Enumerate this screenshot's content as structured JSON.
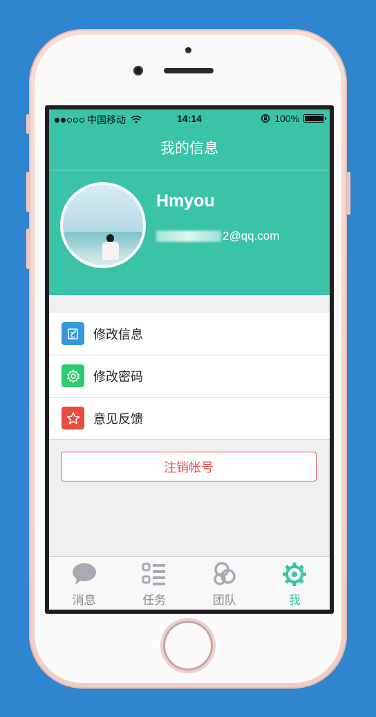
{
  "status_bar": {
    "carrier": "中国移动",
    "time": "14:14",
    "battery": "100%",
    "signal_strength": "2/5"
  },
  "nav": {
    "title": "我的信息"
  },
  "profile": {
    "username": "Hmyou",
    "email_suffix": "2@qq.com"
  },
  "menu": {
    "items": [
      {
        "label": "修改信息",
        "icon": "edit-icon",
        "color": "#3498db"
      },
      {
        "label": "修改密码",
        "icon": "gear-icon",
        "color": "#2ecc71"
      },
      {
        "label": "意见反馈",
        "icon": "star-icon",
        "color": "#e74c3c"
      }
    ]
  },
  "logout": {
    "label": "注销帐号"
  },
  "tab_bar": {
    "tabs": [
      {
        "label": "消息",
        "icon": "chat-bubble-icon",
        "active": false
      },
      {
        "label": "任务",
        "icon": "task-list-icon",
        "active": false
      },
      {
        "label": "团队",
        "icon": "team-icon",
        "active": false
      },
      {
        "label": "我",
        "icon": "gear-icon",
        "active": true
      }
    ]
  },
  "colors": {
    "accent": "#3bc3a8",
    "background": "#2f86cf",
    "danger": "#e5514a",
    "tab_inactive": "#8b8b8b"
  }
}
